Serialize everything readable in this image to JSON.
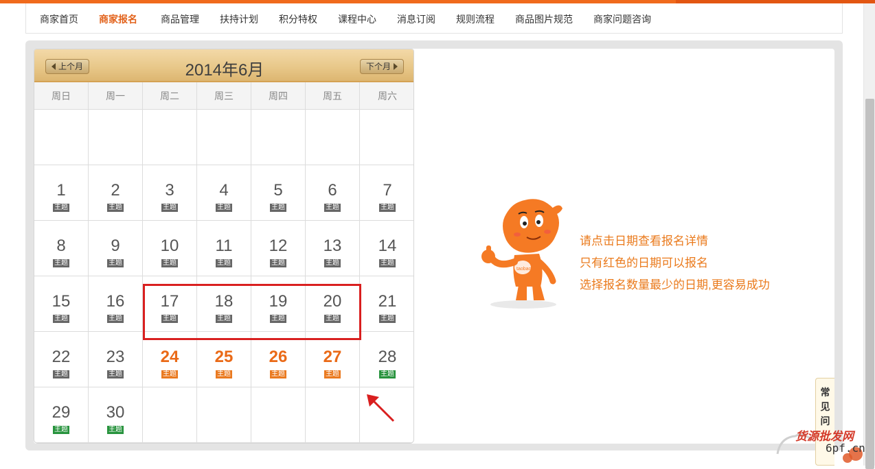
{
  "nav": {
    "items": [
      {
        "label": "商家首页",
        "active": false
      },
      {
        "label": "商家报名",
        "active": true
      },
      {
        "label": "商品管理",
        "active": false
      },
      {
        "label": "扶持计划",
        "active": false
      },
      {
        "label": "积分特权",
        "active": false
      },
      {
        "label": "课程中心",
        "active": false
      },
      {
        "label": "消息订阅",
        "active": false
      },
      {
        "label": "规则流程",
        "active": false
      },
      {
        "label": "商品图片规范",
        "active": false
      },
      {
        "label": "商家问题咨询",
        "active": false
      }
    ]
  },
  "calendar": {
    "title": "2014年6月",
    "prev_label": "上个月",
    "next_label": "下个月",
    "weekdays": [
      "周日",
      "周一",
      "周二",
      "周三",
      "周四",
      "周五",
      "周六"
    ],
    "first_weekday_index": 0,
    "days": [
      {
        "day": "1",
        "tag": "主题",
        "state": "normal"
      },
      {
        "day": "2",
        "tag": "主题",
        "state": "normal"
      },
      {
        "day": "3",
        "tag": "主题",
        "state": "normal"
      },
      {
        "day": "4",
        "tag": "主题",
        "state": "normal"
      },
      {
        "day": "5",
        "tag": "主题",
        "state": "normal"
      },
      {
        "day": "6",
        "tag": "主题",
        "state": "normal"
      },
      {
        "day": "7",
        "tag": "主题",
        "state": "normal"
      },
      {
        "day": "8",
        "tag": "主题",
        "state": "normal"
      },
      {
        "day": "9",
        "tag": "主题",
        "state": "normal"
      },
      {
        "day": "10",
        "tag": "主题",
        "state": "normal"
      },
      {
        "day": "11",
        "tag": "主题",
        "state": "normal"
      },
      {
        "day": "12",
        "tag": "主题",
        "state": "normal"
      },
      {
        "day": "13",
        "tag": "主题",
        "state": "normal"
      },
      {
        "day": "14",
        "tag": "主题",
        "state": "normal"
      },
      {
        "day": "15",
        "tag": "主题",
        "state": "normal"
      },
      {
        "day": "16",
        "tag": "主题",
        "state": "normal"
      },
      {
        "day": "17",
        "tag": "主题",
        "state": "normal"
      },
      {
        "day": "18",
        "tag": "主题",
        "state": "normal"
      },
      {
        "day": "19",
        "tag": "主题",
        "state": "normal"
      },
      {
        "day": "20",
        "tag": "主题",
        "state": "normal"
      },
      {
        "day": "21",
        "tag": "主题",
        "state": "normal"
      },
      {
        "day": "22",
        "tag": "主题",
        "state": "normal"
      },
      {
        "day": "23",
        "tag": "主题",
        "state": "normal"
      },
      {
        "day": "24",
        "tag": "主题",
        "state": "available"
      },
      {
        "day": "25",
        "tag": "主题",
        "state": "available"
      },
      {
        "day": "26",
        "tag": "主题",
        "state": "available"
      },
      {
        "day": "27",
        "tag": "主题",
        "state": "available"
      },
      {
        "day": "28",
        "tag": "主题",
        "state": "green"
      },
      {
        "day": "29",
        "tag": "主题",
        "state": "green"
      },
      {
        "day": "30",
        "tag": "主题",
        "state": "green"
      }
    ],
    "colors": {
      "available": "#ea6a17",
      "green_tag": "#27933d",
      "normal_tag": "#666666",
      "highlight_box": "#d91f1f"
    }
  },
  "info": {
    "lines": [
      "请点击日期查看报名详情",
      "只有红色的日期可以报名",
      "选择报名数量最少的日期,更容易成功"
    ]
  },
  "mascot": {
    "badge_text": "taobao"
  },
  "faq_tab": {
    "label": "常见问"
  },
  "watermark": {
    "line1": "货源批发网",
    "line2": "6pf.cn"
  },
  "brand": {
    "accent": "#f06a1c",
    "text_orange": "#ea7a1c"
  }
}
